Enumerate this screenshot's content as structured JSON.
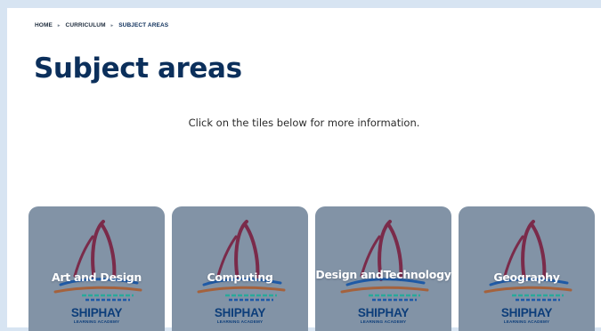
{
  "breadcrumb": {
    "home": "HOME",
    "curriculum": "CURRICULUM",
    "current": "SUBJECT AREAS",
    "separator": "▸"
  },
  "page": {
    "title": "Subject areas",
    "intro": "Click on the tiles below for more information."
  },
  "tiles": [
    {
      "label": "Art and Design"
    },
    {
      "label_line1": "Computing"
    },
    {
      "label_line1": "Design and",
      "label_line2": "Technology"
    },
    {
      "label": "Geography"
    }
  ],
  "logo": {
    "name": "SHIPHAY",
    "subtitle": "LEARNING ACADEMY"
  },
  "colors": {
    "background": "#d7e4f2",
    "title": "#0b2f5b",
    "tile": "#8293a6",
    "logo_text": "#0d3e7a",
    "logo_sail": "#7a2b4a",
    "logo_wave_blue": "#1f5aa6",
    "logo_wave_brown": "#a4623d",
    "logo_wave_teal": "#2aa89a"
  }
}
